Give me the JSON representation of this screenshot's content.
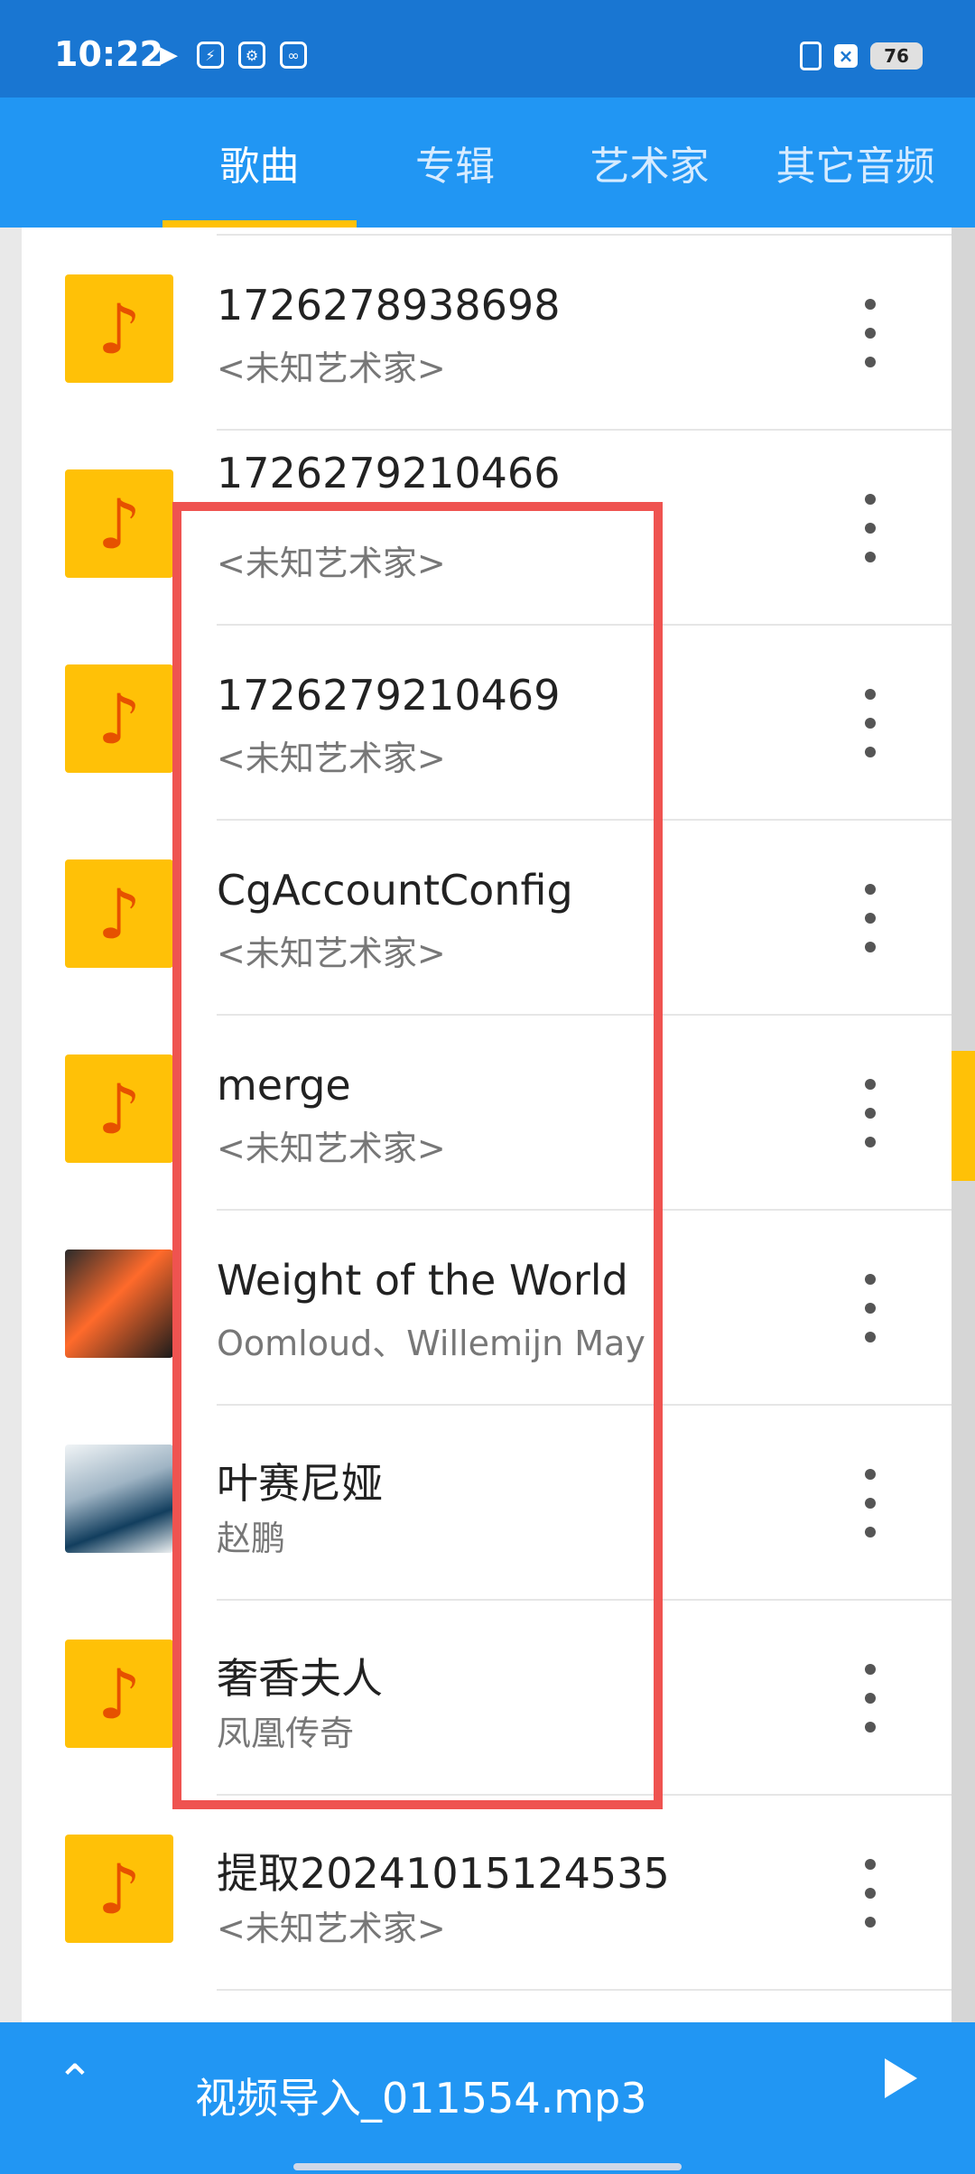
{
  "status_bar": {
    "time": "10:22",
    "battery": "76",
    "left_icons": [
      "play-icon",
      "bolt-icon",
      "settings-icon",
      "link-icon"
    ]
  },
  "tabs": [
    {
      "label": "歌曲",
      "active": true
    },
    {
      "label": "专辑",
      "active": false
    },
    {
      "label": "艺术家",
      "active": false
    },
    {
      "label": "其它音频",
      "active": false
    }
  ],
  "songs": [
    {
      "title": "1726278938698",
      "artist": "<未知艺术家>",
      "thumb": "music-note-icon"
    },
    {
      "title": "1726279210466",
      "artist": "<未知艺术家>",
      "thumb": "music-note-icon"
    },
    {
      "title": "1726279210469",
      "artist": "<未知艺术家>",
      "thumb": "music-note-icon"
    },
    {
      "title": "CgAccountConfig",
      "artist": "<未知艺术家>",
      "thumb": "music-note-icon"
    },
    {
      "title": "merge",
      "artist": "<未知艺术家>",
      "thumb": "music-note-icon"
    },
    {
      "title": "Weight of the World",
      "artist": "Oomloud、Willemijn May",
      "thumb": "album-art"
    },
    {
      "title": "叶赛尼娅",
      "artist": "赵鹏",
      "thumb": "album-art"
    },
    {
      "title": "奢香夫人",
      "artist": "凤凰传奇",
      "thumb": "music-note-icon"
    },
    {
      "title": "提取20241015124535",
      "artist": "<未知艺术家>",
      "thumb": "music-note-icon"
    }
  ],
  "player": {
    "now_playing": "视频导入_011554.mp3"
  },
  "colors": {
    "primary": "#2196f3",
    "status_bar": "#1976d2",
    "accent": "#ffc107",
    "highlight": "#ef5350"
  }
}
